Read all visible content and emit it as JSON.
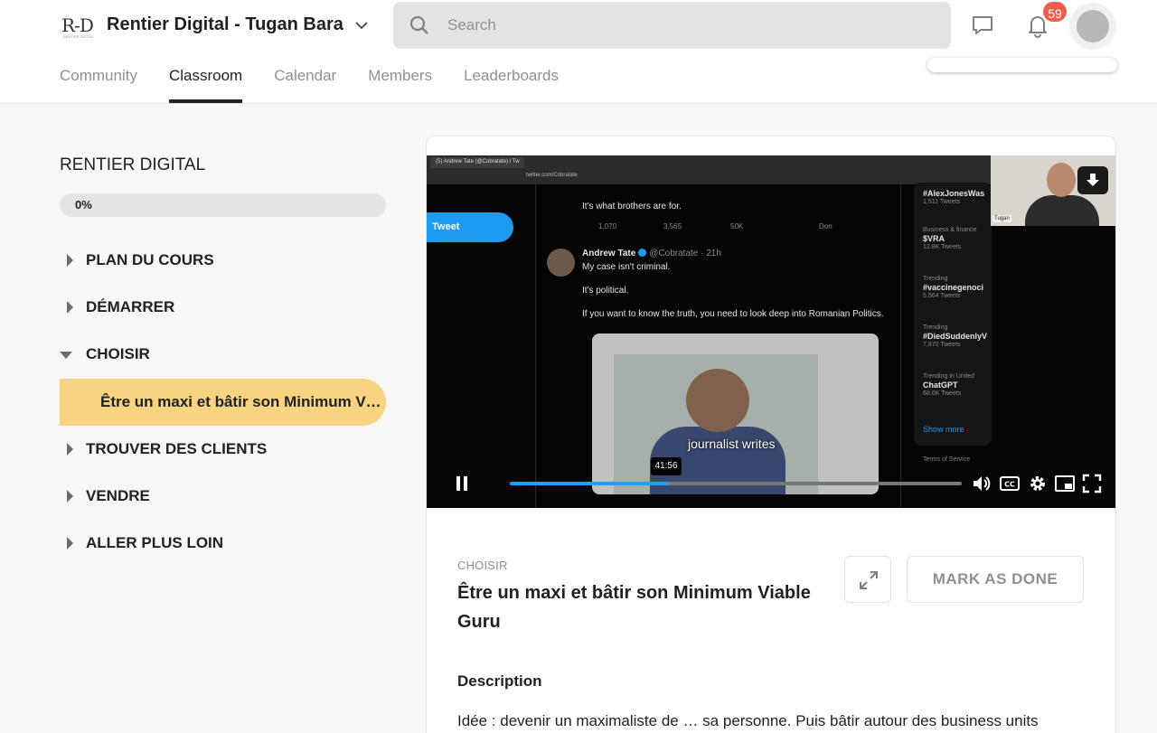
{
  "header": {
    "logo_text": "R-D",
    "logo_subtext": "RENTIER DIGITAL",
    "group_name": "Rentier Digital - Tugan Bara",
    "search_placeholder": "Search",
    "notification_count": "59"
  },
  "nav": {
    "tabs": [
      {
        "label": "Community"
      },
      {
        "label": "Classroom",
        "active": true
      },
      {
        "label": "Calendar"
      },
      {
        "label": "Members"
      },
      {
        "label": "Leaderboards"
      }
    ]
  },
  "sidebar": {
    "course_title": "RENTIER DIGITAL",
    "progress_label": "0%",
    "progress_value": 0,
    "modules": [
      {
        "label": "PLAN DU COURS",
        "expanded": false
      },
      {
        "label": "DÉMARRER",
        "expanded": false
      },
      {
        "label": "CHOISIR",
        "expanded": true
      },
      {
        "label": "TROUVER DES CLIENTS",
        "expanded": false
      },
      {
        "label": "VENDRE",
        "expanded": false
      },
      {
        "label": "ALLER PLUS LOIN",
        "expanded": false
      }
    ],
    "active_lesson": "Être un maxi et bâtir son Minimum Viable Guru"
  },
  "video": {
    "browser_tab": "(5) Andrew Tate (@Cobratate) / Tw",
    "browser_url": "twitter.com/Cobratate",
    "tweet_button": "Tweet",
    "prev_tweet_text": "It's what brothers are for.",
    "prev_tweet_stats": [
      "1,070",
      "3,565",
      "50K",
      "Don"
    ],
    "tweet_author": "Andrew Tate",
    "tweet_handle": "@Cobratate · 21h",
    "tweet_lines": [
      "My case isn't criminal.",
      "It's political.",
      "If you want to know the truth, you need to look deep into Romanian Politics."
    ],
    "subtitle": "journalist writes",
    "trends": [
      {
        "category": "",
        "tag": "#AlexJonesWas",
        "count": "1,511 Tweets"
      },
      {
        "category": "Business & finance",
        "tag": "$VRA",
        "count": "12.8K Tweets"
      },
      {
        "category": "Trending",
        "tag": "#vaccinegenoci",
        "count": "5,564 Tweets"
      },
      {
        "category": "Trending",
        "tag": "#DiedSuddenlyV",
        "count": "7,870 Tweets"
      },
      {
        "category": "Trending in United",
        "tag": "ChatGPT",
        "count": "68.6K Tweets"
      }
    ],
    "show_more": "Show more",
    "terms": "Terms of Service",
    "webcam_name": "Tugan",
    "time_tooltip": "41:56",
    "progress_fraction": 0.35
  },
  "lesson": {
    "category": "CHOISIR",
    "title": "Être un maxi et bâtir son Minimum Viable Guru",
    "mark_done_label": "MARK AS DONE",
    "description_heading": "Description",
    "description_text": "Idée : devenir un maximaliste de … sa personne. Puis bâtir autour des business units"
  },
  "colors": {
    "accent": "#f8d481",
    "badge": "#f15c4b",
    "scrub": "#1da1f2"
  }
}
